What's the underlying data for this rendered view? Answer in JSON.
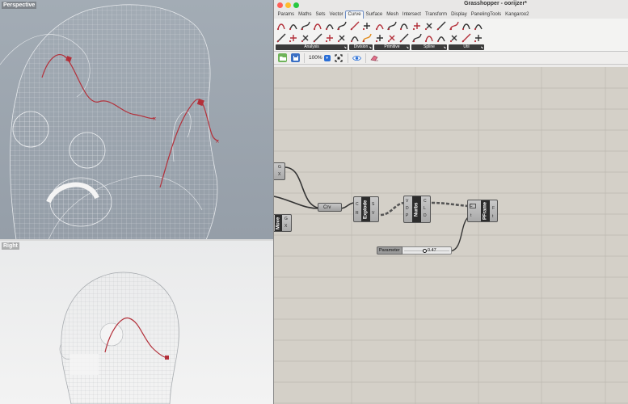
{
  "viewports": {
    "top_label": "Perspective",
    "bottom_label": "Right"
  },
  "window": {
    "title": "Grasshopper - oorijzer*"
  },
  "menu_tabs": [
    "Params",
    "Maths",
    "Sets",
    "Vector",
    "Curve",
    "Surface",
    "Mesh",
    "Intersect",
    "Transform",
    "Display",
    "PanelingTools",
    "Kangaroo2"
  ],
  "active_tab": "Curve",
  "ribbon_groups": [
    "Analysis",
    "Division",
    "Primitive",
    "Spline",
    "Util"
  ],
  "toolbar": {
    "zoom": "100%"
  },
  "components": {
    "left_partial": {
      "ports": [
        "G",
        "X"
      ]
    },
    "move": {
      "name": "Move",
      "ports": [
        "G",
        "X"
      ]
    },
    "crv": {
      "name": "Crv"
    },
    "explode": {
      "name": "Explode",
      "inputs": [
        "C",
        "R"
      ],
      "outputs": [
        "S",
        "V"
      ]
    },
    "nurbs": {
      "name": "Nurbs",
      "inputs": [
        "V",
        "D",
        "P"
      ],
      "outputs": [
        "C",
        "L",
        "D"
      ]
    },
    "pframe": {
      "name": "PFrame",
      "inputs": [
        "C",
        "t"
      ],
      "outputs": [
        "F",
        "t"
      ]
    },
    "slider": {
      "label": "Parameter",
      "value": "0.47"
    }
  },
  "colors": {
    "curve": "#b3303a",
    "canvas": "#d4d0c8",
    "accent": "#2b6fd6"
  }
}
